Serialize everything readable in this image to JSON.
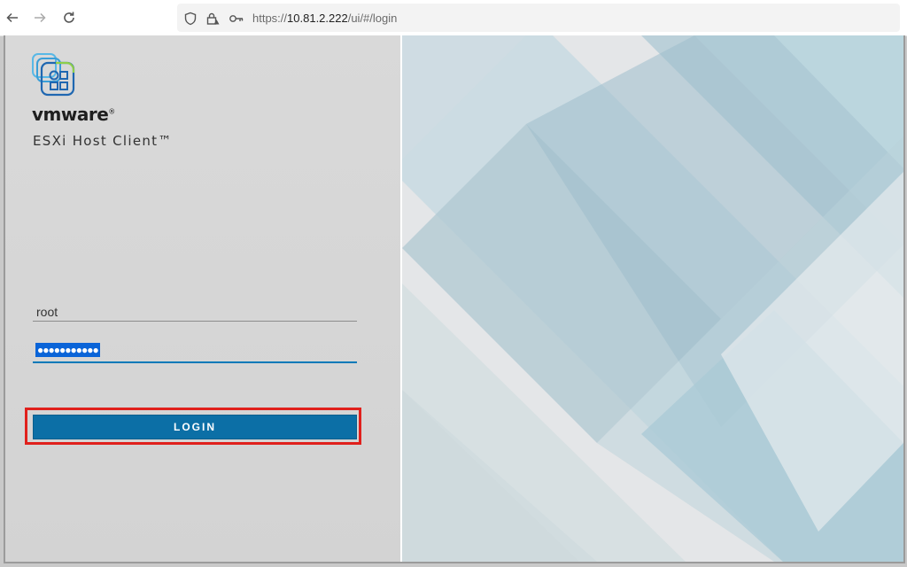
{
  "browser": {
    "url_prefix": "https://",
    "url_host": "10.81.2.222",
    "url_path": "/ui/#/login"
  },
  "login": {
    "brand": "vmware",
    "brand_mark": "®",
    "product": "ESXi Host Client™",
    "username_value": "root",
    "password_mask": "●●●●●●●●●●●",
    "button_label": "LOGIN"
  },
  "colors": {
    "accent": "#0c6fa6",
    "highlight": "#e0201c",
    "panel_bg": "#d6d6d6",
    "art_light": "#e3e6e8",
    "art_blue": "#a9c6d3"
  },
  "icons": [
    "back-arrow-icon",
    "forward-arrow-icon",
    "reload-icon",
    "shield-icon",
    "lock-warning-icon",
    "key-icon",
    "vmware-logo-icon"
  ]
}
